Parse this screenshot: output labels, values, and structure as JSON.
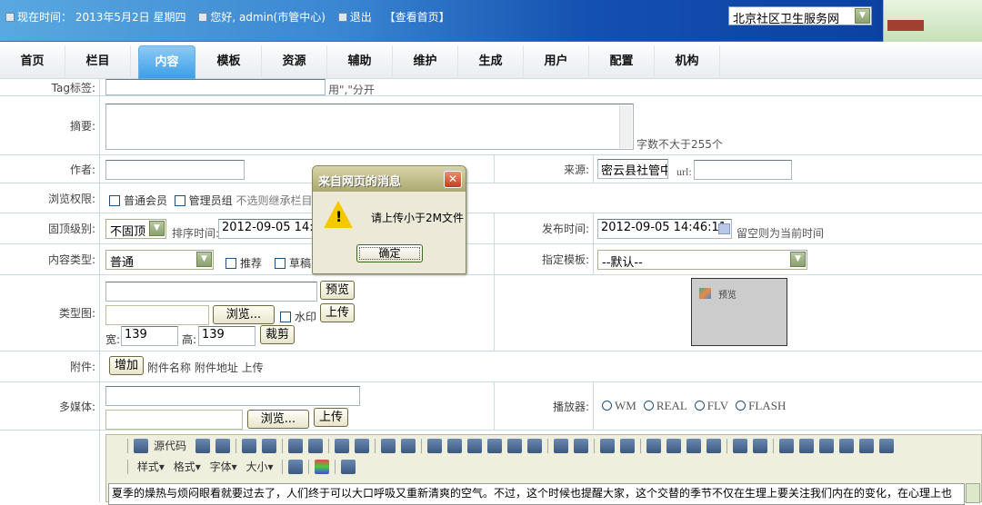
{
  "header": {
    "time_label": "现在时间：",
    "date": "2013年5月2日",
    "weekday": "星期四",
    "greeting": "您好, admin(市管中心)",
    "logout": "退出",
    "view_home": "【查看首页】",
    "site_select": "北京社区卫生服务网"
  },
  "nav": {
    "tabs": [
      "首页",
      "栏目",
      "内容",
      "模板",
      "资源",
      "辅助",
      "维护",
      "生成",
      "用户",
      "配置",
      "机构"
    ],
    "active": "内容"
  },
  "form": {
    "tag": {
      "label": "Tag标签:",
      "hint": "用\",\"分开"
    },
    "summary": {
      "label": "摘要:",
      "hint": "字数不大于255个"
    },
    "author": {
      "label": "作者:",
      "value": ""
    },
    "source": {
      "label": "来源:",
      "value": "密云县社管中",
      "url_label": "url:"
    },
    "permission": {
      "label": "浏览权限:",
      "options": [
        "普通会员",
        "管理员组"
      ],
      "hint": "不选则继承栏目"
    },
    "top_level": {
      "label": "固顶级别:",
      "value": "不固顶",
      "sort_label": "排序时间:",
      "sort_value": "2012-09-05 14:46"
    },
    "publish": {
      "label": "发布时间:",
      "value": "2012-09-05 14:46:11",
      "hint": "留空则为当前时间"
    },
    "content_type": {
      "label": "内容类型:",
      "value": "普通",
      "recommend": "推荐",
      "draft": "草稿"
    },
    "template": {
      "label": "指定模板:",
      "value": "--默认--"
    },
    "type_image": {
      "label": "类型图:",
      "preview_btn": "预览",
      "browse_btn": "浏览...",
      "watermark": "水印",
      "upload_btn": "上传",
      "width_label": "宽:",
      "width": "139",
      "height_label": "高:",
      "height": "139",
      "crop_btn": "裁剪",
      "preview_box": "预览"
    },
    "attachment": {
      "label": "附件:",
      "add_btn": "增加",
      "cols": "附件名称 附件地址 上传"
    },
    "media": {
      "label": "多媒体:",
      "browse_btn": "浏览...",
      "upload_btn": "上传"
    },
    "player": {
      "label": "播放器:",
      "options": [
        "WM",
        "REAL",
        "FLV",
        "FLASH"
      ]
    }
  },
  "editor": {
    "source_label": "源代码",
    "style": "样式",
    "format": "格式",
    "font": "字体",
    "size": "大小",
    "icons1": [
      "preview-icon",
      "print-icon",
      "template-icon",
      "cut-icon",
      "paste-icon",
      "undo-icon",
      "redo-icon",
      "find-icon",
      "replace-icon",
      "select-all-icon",
      "eraser-icon",
      "bold-icon",
      "italic-icon",
      "underline-icon",
      "strike-icon",
      "subscript-icon",
      "superscript-icon",
      "ordered-list-icon",
      "unordered-list-icon",
      "outdent-icon",
      "indent-icon",
      "align-left-icon",
      "align-center-icon",
      "align-right-icon",
      "justify-icon",
      "link-icon",
      "unlink-icon",
      "image-icon",
      "flash-icon",
      "media-icon",
      "table-icon",
      "special-icon"
    ],
    "text": "夏季的燥热与烦闷眼看就要过去了，人们终于可以大口呼吸又重新清爽的空气。不过，这个时候也提醒大家，这个交替的季节不仅在生理上要关注我们内在的变化，在心理上也"
  },
  "dialog": {
    "title": "来自网页的消息",
    "message": "请上传小于2M文件",
    "ok": "确定"
  }
}
